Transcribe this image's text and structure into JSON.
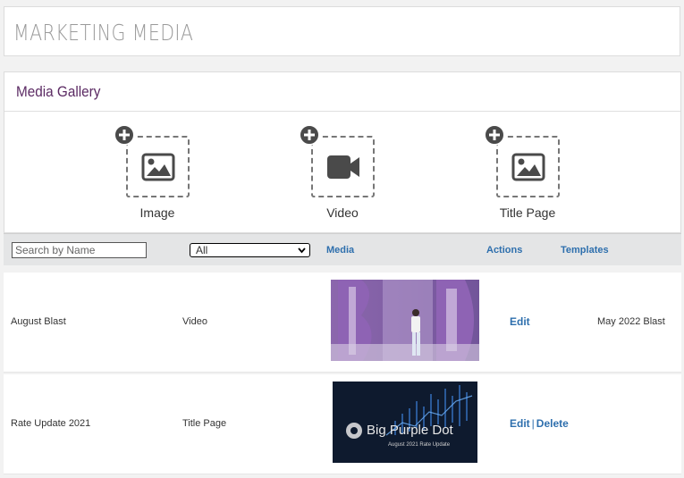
{
  "header": {
    "title": "MARKETING MEDIA"
  },
  "gallery": {
    "title": "Media Gallery",
    "upload_tiles": [
      {
        "label": "Image",
        "icon": "image-icon"
      },
      {
        "label": "Video",
        "icon": "video-camera-icon"
      },
      {
        "label": "Title Page",
        "icon": "image-icon"
      }
    ]
  },
  "filters": {
    "search_placeholder": "Search by Name",
    "type_selected": "All",
    "columns": {
      "media": "Media",
      "actions": "Actions",
      "templates": "Templates"
    }
  },
  "rows": [
    {
      "name": "August Blast",
      "type": "Video",
      "edit": "Edit",
      "delete": "",
      "template": "May 2022 Blast"
    },
    {
      "name": "Rate Update 2021",
      "type": "Title Page",
      "edit": "Edit",
      "delete": "Delete",
      "template": "",
      "thumb_brand": "Big Purple Dot",
      "thumb_caption": "August 2021 Rate Update"
    }
  ],
  "colors": {
    "accent_purple": "#5b2a63",
    "link_blue": "#2e6fad",
    "icon_gray": "#4a4a4a"
  }
}
